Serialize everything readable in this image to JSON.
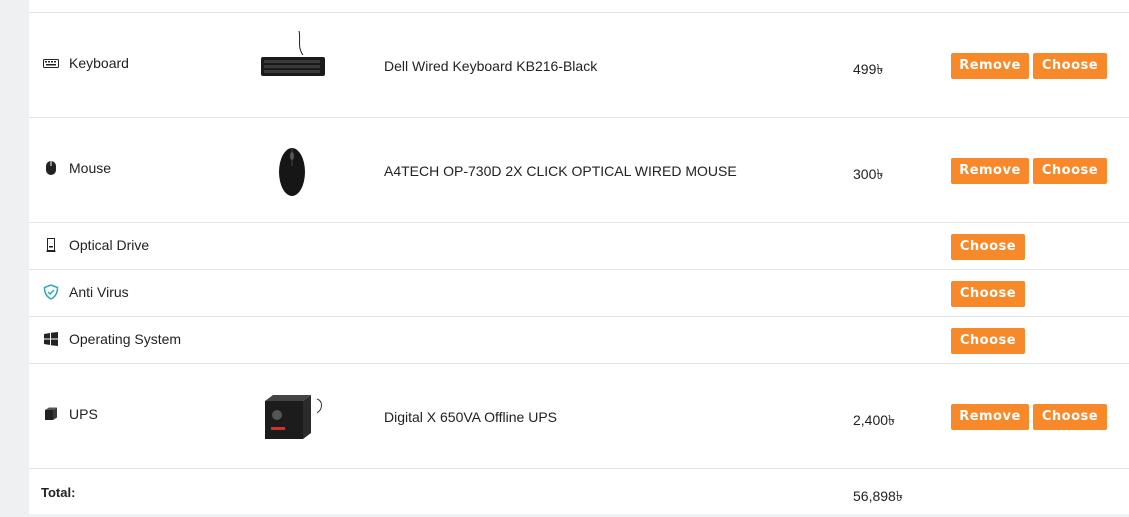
{
  "rows": [
    {
      "category": "Keyboard",
      "icon": "keyboard-icon",
      "product": "Dell Wired Keyboard KB216-Black",
      "price": "499৳",
      "remove": "Remove",
      "choose": "Choose"
    },
    {
      "category": "Mouse",
      "icon": "mouse-icon",
      "product": "A4TECH OP-730D 2X CLICK OPTICAL WIRED MOUSE",
      "price": "300৳",
      "remove": "Remove",
      "choose": "Choose"
    },
    {
      "category": "Optical Drive",
      "icon": "optical-drive-icon",
      "choose": "Choose"
    },
    {
      "category": "Anti Virus",
      "icon": "shield-icon",
      "choose": "Choose"
    },
    {
      "category": "Operating System",
      "icon": "windows-icon",
      "choose": "Choose"
    },
    {
      "category": "UPS",
      "icon": "ups-icon",
      "product": "Digital X 650VA Offline UPS",
      "price": "2,400৳",
      "remove": "Remove",
      "choose": "Choose"
    }
  ],
  "total": {
    "label": "Total:",
    "value": "56,898৳"
  },
  "colors": {
    "button": "#f7892a",
    "shield": "#2aa9b8"
  }
}
